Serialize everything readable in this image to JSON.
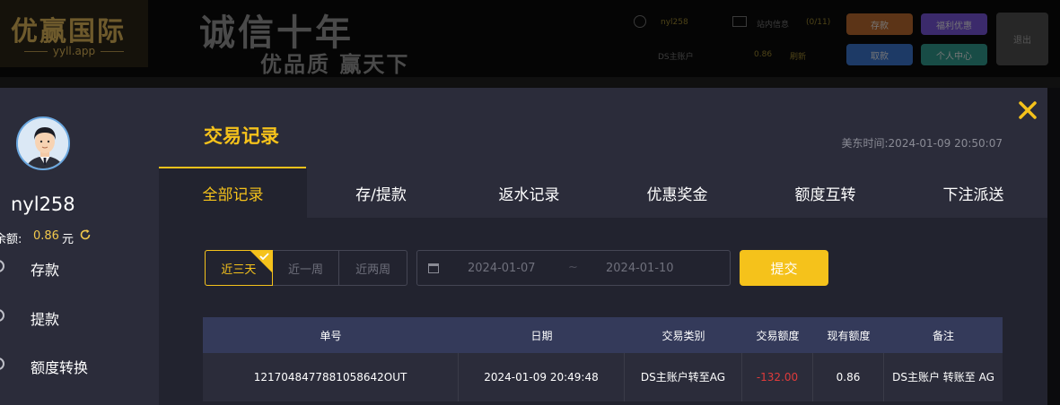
{
  "header": {
    "logo_main": "优赢国际",
    "logo_sub": "yyll.app",
    "slogan_line1": "诚信十年",
    "slogan_line2": "优品质 赢天下",
    "username": "nyl258",
    "messages_label": "站内信息",
    "messages_count": "(0/11)",
    "wallet_label": "DS主账户",
    "wallet_value": "0.86",
    "refresh_label": "刷新",
    "deposit_button": "存款",
    "promo_button": "福利优惠",
    "withdraw_button": "取款",
    "center_button": "个人中心",
    "logout_button": "退出"
  },
  "sidebar": {
    "username": "nyl258",
    "balance_label": "余额:",
    "balance_value": "0.86",
    "balance_unit": "元",
    "items": [
      {
        "label": "存款"
      },
      {
        "label": "提款"
      },
      {
        "label": "额度转换"
      }
    ]
  },
  "modal": {
    "title": "交易记录",
    "time_label": "美东时间:",
    "time_value": "2024-01-09 20:50:07"
  },
  "tabs": [
    {
      "label": "全部记录",
      "active": true
    },
    {
      "label": "存/提款"
    },
    {
      "label": "返水记录"
    },
    {
      "label": "优惠奖金"
    },
    {
      "label": "额度互转"
    },
    {
      "label": "下注派送"
    }
  ],
  "filters": {
    "ranges": [
      "近三天",
      "近一周",
      "近两周"
    ],
    "active_range": "近三天",
    "date_start": "2024-01-07",
    "date_separator": "~",
    "date_end": "2024-01-10",
    "submit_label": "提交"
  },
  "table": {
    "columns": [
      "单号",
      "日期",
      "交易类别",
      "交易额度",
      "现有额度",
      "备注"
    ],
    "rows": [
      [
        "1217048477881058642OUT",
        "2024-01-09 20:49:48",
        "DS主账户转至AG",
        "-132.00",
        "0.86",
        "DS主账户 转账至 AG"
      ]
    ]
  },
  "colors": {
    "accent": "#f5c21b",
    "negative": "#e03b3b",
    "panel": "#22232f",
    "sidebar": "#2b2c3a",
    "table_header": "#343a5a"
  }
}
